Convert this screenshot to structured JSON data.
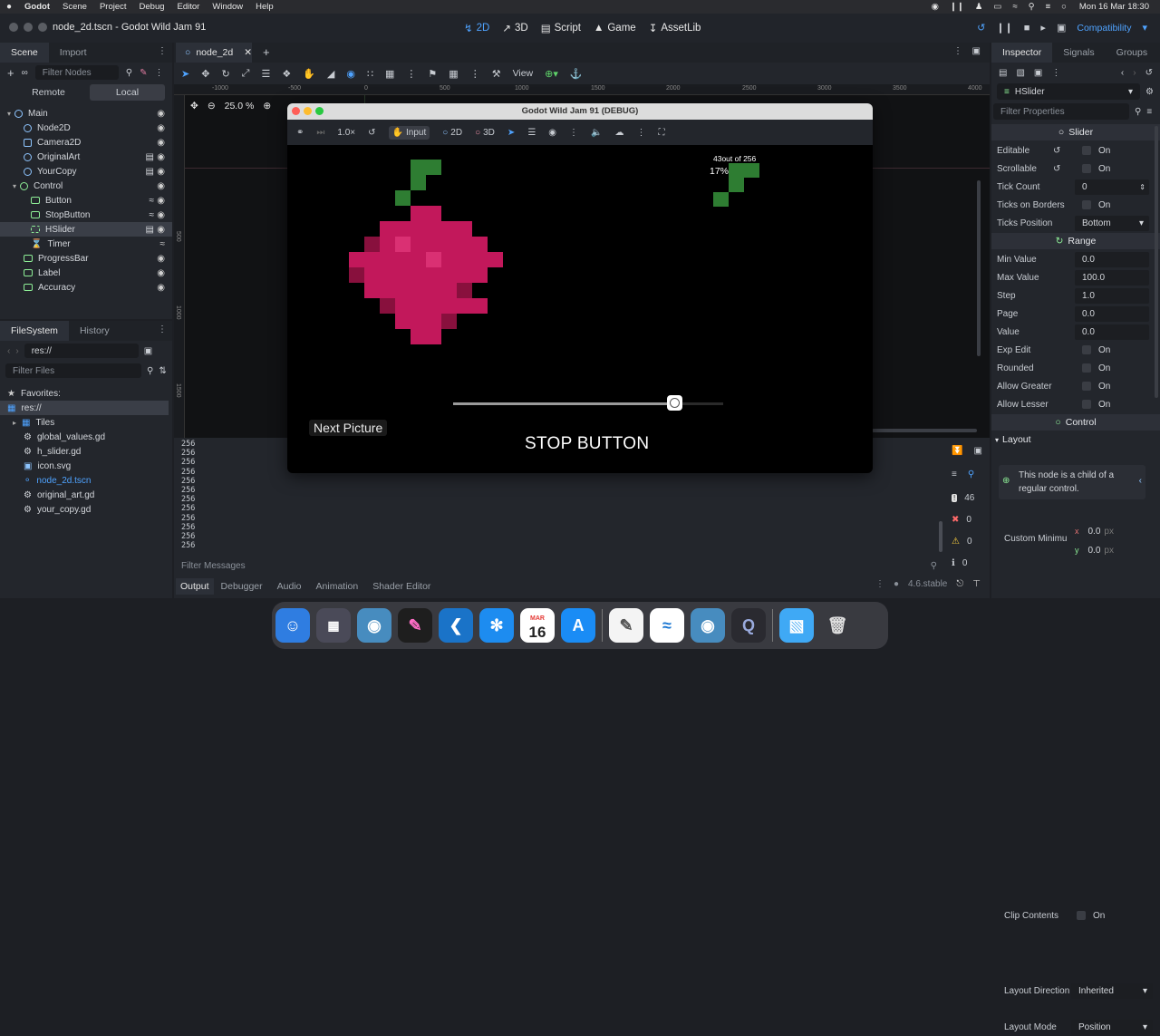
{
  "menubar": {
    "apple": "",
    "items": [
      "Godot",
      "Scene",
      "Project",
      "Debug",
      "Editor",
      "Window",
      "Help"
    ],
    "clock": "Mon 16 Mar  18:30"
  },
  "titlebar": {
    "tab": "node_2d.tscn - Godot Wild Jam 91",
    "workspaces": [
      "2D",
      "3D",
      "Script",
      "Game",
      "AssetLib"
    ],
    "renderer": "Compatibility"
  },
  "scene_dock": {
    "tabs": [
      "Scene",
      "Import"
    ],
    "filter_placeholder": "Filter Nodes",
    "remote": "Remote",
    "local": "Local",
    "nodes": [
      "Main",
      "Node2D",
      "Camera2D",
      "OriginalArt",
      "YourCopy",
      "Control",
      "Button",
      "StopButton",
      "HSlider",
      "Timer",
      "ProgressBar",
      "Label",
      "Accuracy"
    ]
  },
  "filesystem": {
    "tabs": [
      "FileSystem",
      "History"
    ],
    "path": "res://",
    "filter_placeholder": "Filter Files",
    "favorites": "Favorites:",
    "root": "res://",
    "items": [
      "Tiles",
      "global_values.gd",
      "h_slider.gd",
      "icon.svg",
      "node_2d.tscn",
      "original_art.gd",
      "your_copy.gd"
    ]
  },
  "viewport": {
    "scene_tab": "node_2d",
    "zoom": "25.0 %",
    "view": "View",
    "ruler": [
      "-1000",
      "-500",
      "0",
      "500",
      "1000",
      "1500",
      "2000",
      "2500",
      "3000",
      "3500",
      "4000"
    ],
    "vruler": [
      "500",
      "1000",
      "1500"
    ]
  },
  "game_window": {
    "title": "Godot Wild Jam 91 (DEBUG)",
    "speed": "1.0×",
    "input": "Input",
    "m2d": "2D",
    "m3d": "3D",
    "counter": "43out of 256",
    "percent": "17%",
    "next_picture": "Next Picture",
    "stop_button": "STOP BUTTON",
    "slider_value": 0.82
  },
  "output": {
    "lines": [
      "256",
      "256",
      "256",
      "256",
      "256",
      "256",
      "256",
      "256",
      "256",
      "256",
      "256",
      "256",
      "256",
      "256"
    ],
    "filter_placeholder": "Filter Messages",
    "counts": [
      "46",
      "0",
      "0",
      "0"
    ],
    "tabs": [
      "Output",
      "Debugger",
      "Audio",
      "Animation",
      "Shader Editor"
    ],
    "version": "4.6.stable"
  },
  "inspector": {
    "tabs": [
      "Inspector",
      "Signals",
      "Groups"
    ],
    "node": "HSlider",
    "filter_placeholder": "Filter Properties",
    "section_slider": "Slider",
    "slider_props": [
      {
        "label": "Editable",
        "value": "On"
      },
      {
        "label": "Scrollable",
        "value": "On"
      },
      {
        "label": "Tick Count",
        "value": "0"
      },
      {
        "label": "Ticks on Borders",
        "value": "On"
      },
      {
        "label": "Ticks Position",
        "value": "Bottom"
      }
    ],
    "section_range": "Range",
    "range_props": [
      {
        "label": "Min Value",
        "value": "0.0"
      },
      {
        "label": "Max Value",
        "value": "100.0"
      },
      {
        "label": "Step",
        "value": "1.0"
      },
      {
        "label": "Page",
        "value": "0.0"
      },
      {
        "label": "Value",
        "value": "0.0"
      },
      {
        "label": "Exp Edit",
        "value": "On"
      },
      {
        "label": "Rounded",
        "value": "On"
      },
      {
        "label": "Allow Greater",
        "value": "On"
      },
      {
        "label": "Allow Lesser",
        "value": "On"
      }
    ],
    "section_control": "Control",
    "layout": "Layout",
    "note": "This node is a child of a regular control.",
    "clip_contents": "Clip Contents",
    "clip_value": "On",
    "custom_min": "Custom Minimu",
    "cx": "0.0",
    "cy": "0.0",
    "px": "px",
    "layout_dir": "Layout Direction",
    "layout_dir_val": "Inherited",
    "layout_mode": "Layout Mode",
    "layout_mode_val": "Position"
  },
  "dock": {
    "calendar_month": "MAR",
    "calendar_day": "16"
  },
  "colors": {
    "accent": "#4fa3ff",
    "apple_pink": "#c2185b",
    "leaf": "#2e7d32"
  }
}
